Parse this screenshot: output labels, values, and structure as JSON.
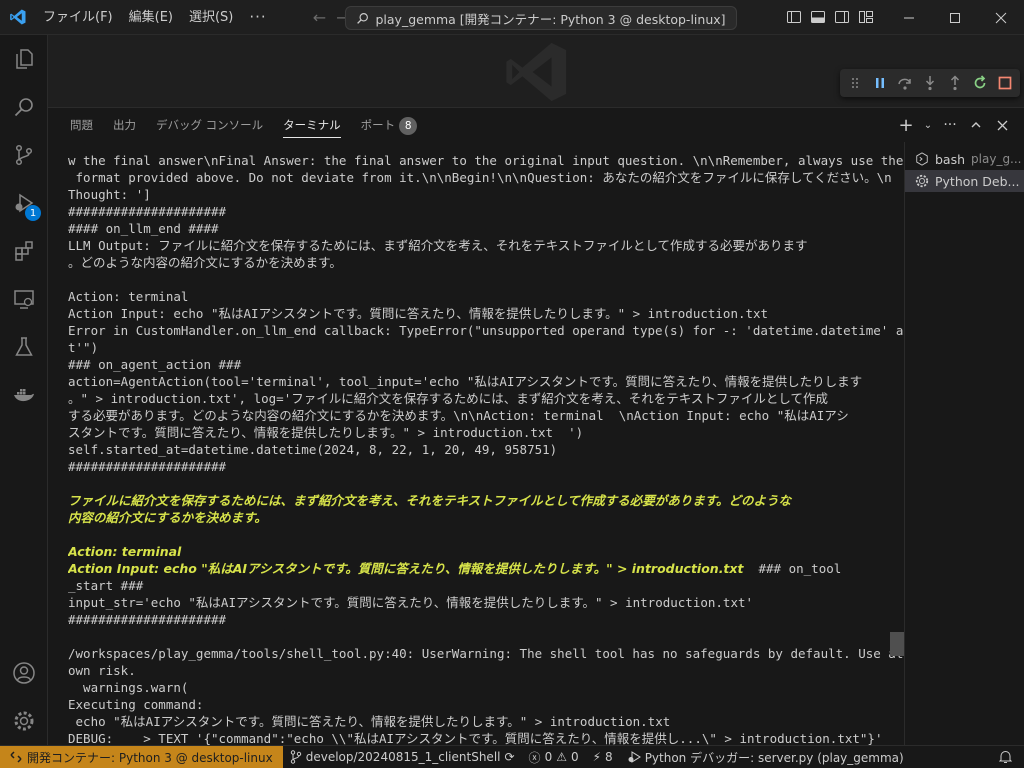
{
  "titlebar": {
    "menu": [
      "ファイル(F)",
      "編集(E)",
      "選択(S)"
    ],
    "more": "···",
    "search": "play_gemma [開発コンテナー: Python 3 @ desktop-linux]"
  },
  "activity": {
    "debug_badge": "1"
  },
  "panel": {
    "tabs": [
      "問題",
      "出力",
      "デバッグ コンソール",
      "ターミナル",
      "ポート"
    ],
    "ports_count": "8",
    "terminals": [
      {
        "name": "bash",
        "sub": "play_g..."
      },
      {
        "name": "Python Deb...",
        "sub": ""
      }
    ]
  },
  "terminal": {
    "lines": [
      "w the final answer\\nFinal Answer: the final answer to the original input question. \\n\\nRemember, always use the exact",
      " format provided above. Do not deviate from it.\\n\\nBegin!\\n\\nQuestion: あなたの紹介文をファイルに保存してください。\\n",
      "Thought: ']",
      "#####################",
      "#### on_llm_end ####",
      "LLM Output: ファイルに紹介文を保存するためには、まず紹介文を考え、それをテキストファイルとして作成する必要があります",
      "。どのような内容の紹介文にするかを決めます。",
      "",
      "Action: terminal",
      "Action Input: echo \"私はAIアシスタントです。質問に答えたり、情報を提供したりします。\" > introduction.txt",
      "Error in CustomHandler.on_llm_end callback: TypeError(\"unsupported operand type(s) for -: 'datetime.datetime' and 'in",
      "t'\")",
      "### on_agent_action ###",
      "action=AgentAction(tool='terminal', tool_input='echo \"私はAIアシスタントです。質問に答えたり、情報を提供したりします",
      "。\" > introduction.txt', log='ファイルに紹介文を保存するためには、まず紹介文を考え、それをテキストファイルとして作成",
      "する必要があります。どのような内容の紹介文にするかを決めます。\\n\\nAction: terminal  \\nAction Input: echo \"私はAIアシ",
      "スタントです。質問に答えたり、情報を提供したりします。\" > introduction.txt  ')",
      "self.started_at=datetime.datetime(2024, 8, 22, 1, 20, 49, 958751)",
      "#####################",
      "",
      "ファイルに紹介文を保存するためには、まず紹介文を考え、それをテキストファイルとして作成する必要があります。どのような",
      "内容の紹介文にするかを決めます。",
      "",
      "Action: terminal",
      "Action Input: echo \"私はAIアシスタントです。質問に答えたり、情報を提供したりします。\" > introduction.txt",
      "_start ###",
      "input_str='echo \"私はAIアシスタントです。質問に答えたり、情報を提供したりします。\" > introduction.txt'",
      "#####################",
      "",
      "/workspaces/play_gemma/tools/shell_tool.py:40: UserWarning: The shell tool has no safeguards by default. Use at your",
      "own risk.",
      "  warnings.warn(",
      "Executing command:",
      " echo \"私はAIアシスタントです。質問に答えたり、情報を提供したりします。\" > introduction.txt",
      "DEBUG:    > TEXT '{\"command\":\"echo \\\\\"私はAIアシスタントです。質問に答えたり、情報を提供し...\\\" > introduction.txt\"}'"
    ],
    "line25_suffix": "  ### on_tool"
  },
  "statusbar": {
    "remote": "開発コンテナー: Python 3 @ desktop-linux",
    "branch": "develop/20240815_1_clientShell",
    "errors": "0",
    "warnings": "0",
    "ports": "8",
    "debugger": "Python デバッガー: server.py (play_gemma)"
  },
  "colors": {
    "accent": "#0078d4",
    "remote": "#c5851a",
    "agent_text": "#d7e34a"
  }
}
